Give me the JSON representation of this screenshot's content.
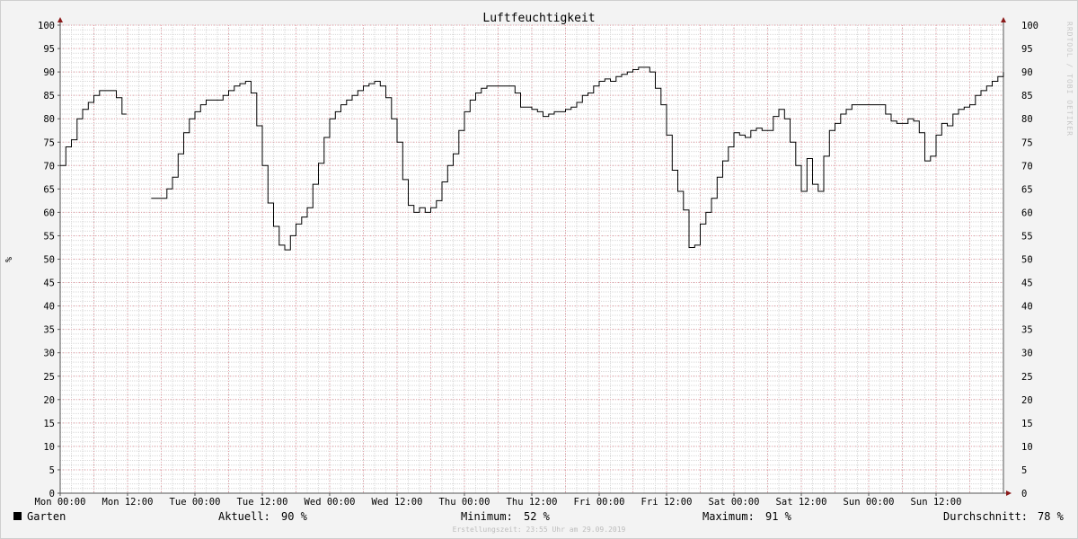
{
  "chart_data": {
    "type": "line",
    "title": "Luftfeuchtigkeit",
    "ylabel": "%",
    "ylim": [
      0,
      100
    ],
    "yticks": [
      0,
      5,
      10,
      15,
      20,
      25,
      30,
      35,
      40,
      45,
      50,
      55,
      60,
      65,
      70,
      75,
      80,
      85,
      90,
      95,
      100
    ],
    "xlim": [
      0,
      168
    ],
    "x_ticks": [
      {
        "h": 0,
        "label": "Mon 00:00"
      },
      {
        "h": 12,
        "label": "Mon 12:00"
      },
      {
        "h": 24,
        "label": "Tue 00:00"
      },
      {
        "h": 36,
        "label": "Tue 12:00"
      },
      {
        "h": 48,
        "label": "Wed 00:00"
      },
      {
        "h": 60,
        "label": "Wed 12:00"
      },
      {
        "h": 72,
        "label": "Thu 00:00"
      },
      {
        "h": 84,
        "label": "Thu 12:00"
      },
      {
        "h": 96,
        "label": "Fri 00:00"
      },
      {
        "h": 108,
        "label": "Fri 12:00"
      },
      {
        "h": 120,
        "label": "Sat 00:00"
      },
      {
        "h": 132,
        "label": "Sat 12:00"
      },
      {
        "h": 144,
        "label": "Sun 00:00"
      },
      {
        "h": 156,
        "label": "Sun 12:00"
      }
    ],
    "series": [
      {
        "name": "Garten",
        "color": "#000000",
        "segments": [
          [
            [
              0,
              70
            ],
            [
              1,
              74
            ],
            [
              2,
              75.5
            ],
            [
              3,
              80
            ],
            [
              4,
              82
            ],
            [
              5,
              83.5
            ],
            [
              6,
              85
            ],
            [
              7,
              86
            ],
            [
              8,
              86
            ],
            [
              9,
              86
            ],
            [
              10,
              84.5
            ],
            [
              11,
              81
            ],
            [
              11.8,
              81
            ]
          ],
          [
            [
              16.2,
              63
            ],
            [
              17,
              63
            ],
            [
              18,
              63
            ],
            [
              19,
              65
            ],
            [
              20,
              67.5
            ],
            [
              21,
              72.5
            ],
            [
              22,
              77
            ],
            [
              23,
              80
            ],
            [
              24,
              81.5
            ],
            [
              25,
              83
            ],
            [
              26,
              84
            ],
            [
              27,
              84
            ],
            [
              28,
              84
            ],
            [
              29,
              85
            ],
            [
              30,
              86
            ],
            [
              31,
              87
            ],
            [
              32,
              87.5
            ],
            [
              33,
              88
            ],
            [
              34,
              85.5
            ],
            [
              35,
              78.5
            ],
            [
              36,
              70
            ],
            [
              37,
              62
            ],
            [
              38,
              57
            ],
            [
              39,
              53
            ],
            [
              40,
              52
            ],
            [
              41,
              55
            ],
            [
              42,
              57.5
            ],
            [
              43,
              59
            ],
            [
              44,
              61
            ],
            [
              45,
              66
            ],
            [
              46,
              70.5
            ],
            [
              47,
              76
            ],
            [
              48,
              80
            ],
            [
              49,
              81.5
            ],
            [
              50,
              83
            ],
            [
              51,
              84
            ],
            [
              52,
              85
            ],
            [
              53,
              86
            ],
            [
              54,
              87
            ],
            [
              55,
              87.5
            ],
            [
              56,
              88
            ],
            [
              57,
              87
            ],
            [
              58,
              84.5
            ],
            [
              59,
              80
            ],
            [
              60,
              75
            ],
            [
              61,
              67
            ],
            [
              62,
              61.5
            ],
            [
              63,
              60
            ],
            [
              64,
              61
            ],
            [
              65,
              60
            ],
            [
              66,
              61
            ],
            [
              67,
              62.5
            ],
            [
              68,
              66.5
            ],
            [
              69,
              70
            ],
            [
              70,
              72.5
            ],
            [
              71,
              77.5
            ],
            [
              72,
              81.5
            ],
            [
              73,
              84
            ],
            [
              74,
              85.5
            ],
            [
              75,
              86.5
            ],
            [
              76,
              87
            ],
            [
              77,
              87
            ],
            [
              78,
              87
            ],
            [
              79,
              87
            ],
            [
              80,
              87
            ],
            [
              81,
              85.5
            ],
            [
              82,
              82.5
            ],
            [
              83,
              82.5
            ],
            [
              84,
              82
            ],
            [
              85,
              81.5
            ],
            [
              86,
              80.5
            ],
            [
              87,
              81
            ],
            [
              88,
              81.5
            ],
            [
              89,
              81.5
            ],
            [
              90,
              82
            ],
            [
              91,
              82.5
            ],
            [
              92,
              83.5
            ],
            [
              93,
              85
            ],
            [
              94,
              85.5
            ],
            [
              95,
              87
            ],
            [
              96,
              88
            ],
            [
              97,
              88.5
            ],
            [
              98,
              88
            ],
            [
              99,
              89
            ],
            [
              100,
              89.5
            ],
            [
              101,
              90
            ],
            [
              102,
              90.5
            ],
            [
              103,
              91
            ],
            [
              104,
              91
            ],
            [
              105,
              90
            ],
            [
              106,
              86.5
            ],
            [
              107,
              83
            ],
            [
              108,
              76.5
            ],
            [
              109,
              69
            ],
            [
              110,
              64.5
            ],
            [
              111,
              60.5
            ],
            [
              112,
              52.5
            ],
            [
              113,
              53
            ],
            [
              114,
              57.5
            ],
            [
              115,
              60
            ],
            [
              116,
              63
            ],
            [
              117,
              67.5
            ],
            [
              118,
              71
            ],
            [
              119,
              74
            ],
            [
              120,
              77
            ],
            [
              121,
              76.5
            ],
            [
              122,
              76
            ],
            [
              123,
              77.5
            ],
            [
              124,
              78
            ],
            [
              125,
              77.5
            ],
            [
              126,
              77.5
            ],
            [
              127,
              80.5
            ],
            [
              128,
              82
            ],
            [
              129,
              80
            ],
            [
              130,
              75
            ],
            [
              131,
              70
            ],
            [
              132,
              64.5
            ],
            [
              133,
              71.5
            ],
            [
              134,
              66
            ],
            [
              135,
              64.5
            ],
            [
              136,
              72
            ],
            [
              137,
              77.5
            ],
            [
              138,
              79
            ],
            [
              139,
              81
            ],
            [
              140,
              82
            ],
            [
              141,
              83
            ],
            [
              142,
              83
            ],
            [
              143,
              83
            ],
            [
              144,
              83
            ],
            [
              145,
              83
            ],
            [
              146,
              83
            ],
            [
              147,
              81
            ],
            [
              148,
              79.5
            ],
            [
              149,
              79
            ],
            [
              150,
              79
            ],
            [
              151,
              80
            ],
            [
              152,
              79.5
            ],
            [
              153,
              77
            ],
            [
              154,
              71
            ],
            [
              155,
              72
            ],
            [
              156,
              76.5
            ],
            [
              157,
              79
            ],
            [
              158,
              78.5
            ],
            [
              159,
              81
            ],
            [
              160,
              82
            ],
            [
              161,
              82.5
            ],
            [
              162,
              83
            ],
            [
              163,
              85
            ],
            [
              164,
              86
            ],
            [
              165,
              87
            ],
            [
              166,
              88
            ],
            [
              167,
              89
            ],
            [
              168,
              90
            ]
          ]
        ]
      }
    ]
  },
  "legend": {
    "name": "Garten",
    "current_label": "Aktuell:",
    "current_value": "90 %",
    "min_label": "Minimum:",
    "min_value": "52 %",
    "max_label": "Maximum:",
    "max_value": "91 %",
    "avg_label": "Durchschnitt:",
    "avg_value": "78 %"
  },
  "footer": "Erstellungszeit: 23:55 Uhr am 29.09.2019",
  "watermark": "RRDTOOL / TOBI OETIKER",
  "colors": {
    "background": "#f3f3f3",
    "plot": "#ffffff",
    "grid_minor": "#d9d9d9",
    "grid_major": "#e8a0a8",
    "axis_arrow": "#8b1a1a"
  }
}
